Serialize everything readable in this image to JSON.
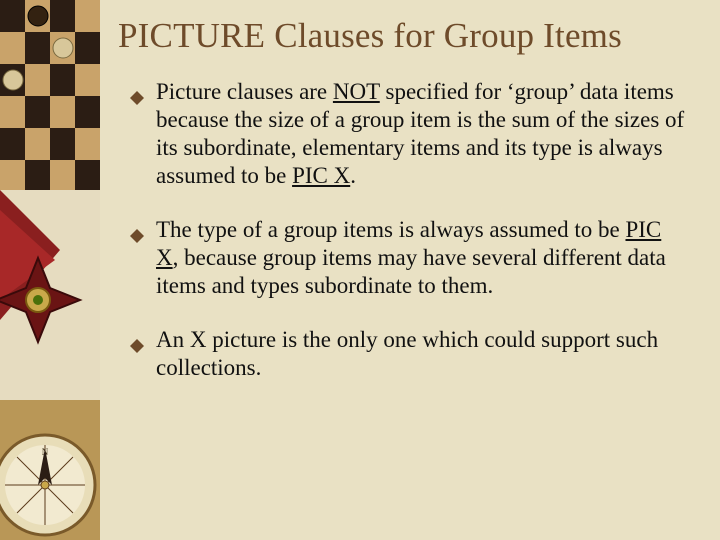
{
  "title": "PICTURE Clauses for Group Items",
  "bullets": [
    {
      "pre": "Picture clauses are ",
      "not": "NOT",
      "mid": " specified for  ‘group’ data items because the size of a group item is the sum of the sizes of its subordinate, elementary items and its type is always assumed to be ",
      "picx": "PIC X",
      "post": "."
    },
    {
      "pre": "The type of a group items is always assumed to be ",
      "picx": "PIC X",
      "post": ", because group items may have several different data items and types subordinate to them."
    },
    {
      "pre": "An X picture is the only one which could support such collections."
    }
  ],
  "icons": {
    "bullet": "diamond-icon"
  },
  "colors": {
    "background": "#e9e1c4",
    "accent": "#6e4b2a",
    "text": "#111111"
  }
}
